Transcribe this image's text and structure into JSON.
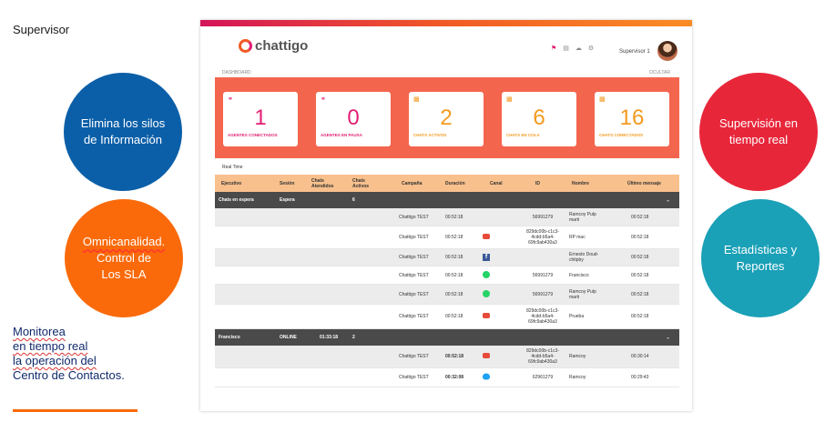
{
  "slide": {
    "title": "Supervisor",
    "circles": [
      {
        "text": "Elimina los silos de Información"
      },
      {
        "lines": [
          "Omnicanalidad.",
          "Control de",
          "Los SLA"
        ]
      },
      {
        "text": "Supervisión en tiempo real"
      },
      {
        "text": "Estadísticas y Reportes"
      }
    ],
    "note": [
      "Monitorea",
      "en tiempo real",
      "la operación del",
      "Centro de Contactos."
    ],
    "colors": {
      "blue": "#0b5fa8",
      "orange": "#fa6a0a",
      "red": "#e8263a",
      "teal": "#1aa0b7"
    }
  },
  "app": {
    "logo_text": "chattigo",
    "user": "Supervisor 1",
    "icons": [
      "notification-icon",
      "clipboard-icon",
      "cloud-icon",
      "settings-icon"
    ],
    "breadcrumb": "DASHBOARD",
    "hide_label": "OCULTAR",
    "cards": [
      {
        "value": "1",
        "label": "AGENTES CONECTADOS",
        "icon": "headset-icon",
        "color": "#e21f73"
      },
      {
        "value": "0",
        "label": "AGENTES EN PAUSA",
        "icon": "headset-icon",
        "color": "#e21f73"
      },
      {
        "value": "2",
        "label": "CHATS ACTIVOS",
        "icon": "chat-icon",
        "color": "#f39a1f"
      },
      {
        "value": "6",
        "label": "CHATS EN COLA",
        "icon": "chat-icon",
        "color": "#f39a1f"
      },
      {
        "value": "16",
        "label": "CHATS CONECTADOS",
        "icon": "chat-icon",
        "color": "#f39a1f"
      }
    ],
    "realtime_label": "Real Time",
    "columns": [
      "Ejecutivo",
      "Sesión",
      "Chats Atendidos",
      "Chats Activos",
      "Campaña",
      "Duración",
      "Canal",
      "ID",
      "Nombre",
      "Último mensaje"
    ],
    "groups": [
      {
        "ejecutivo": "Chats en espera",
        "sesion": "Espera",
        "atendidos": "",
        "activos": "6",
        "rows": [
          {
            "campana": "Chattigo TEST",
            "duracion": "00:52:18",
            "canal": "none",
            "id": "56991279",
            "nombre": "Ramcoy Pulp marti",
            "ultimo": "00:52:18"
          },
          {
            "campana": "Chattigo TEST",
            "duracion": "00:52:18",
            "canal": "chat",
            "id": "829dc00b-c1c3-4cdd-b5a4-69fc9ab430a3",
            "nombre": "RP mac",
            "ultimo": "00:52:18"
          },
          {
            "campana": "Chattigo TEST",
            "duracion": "00:52:18",
            "canal": "facebook",
            "id": "",
            "nombre": "Ernesto Doud-chitpby",
            "ultimo": "00:52:18"
          },
          {
            "campana": "Chattigo TEST",
            "duracion": "00:52:18",
            "canal": "whatsapp",
            "id": "56991279",
            "nombre": "Francisco",
            "ultimo": "00:52:18"
          },
          {
            "campana": "Chattigo TEST",
            "duracion": "00:52:18",
            "canal": "whatsapp",
            "id": "56991279",
            "nombre": "Ramcoy Pulp marti",
            "ultimo": "00:52:18"
          },
          {
            "campana": "Chattigo TEST",
            "duracion": "00:52:18",
            "canal": "chat",
            "id": "829dc00b-c1c3-4cdd-b5a4-69fc9ab430a3",
            "nombre": "Prueba",
            "ultimo": "00:52:18"
          }
        ]
      },
      {
        "ejecutivo": "Francisco",
        "sesion": "ONLINE",
        "atendidos": "01:33:18",
        "activos": "2",
        "rows": [
          {
            "campana": "Chattigo TEST",
            "duracion": "00:52:18",
            "canal": "chat",
            "id": "829dc00b-c1c3-4cdd-b5a4-69fc9ab430a3",
            "nombre": "Ramcoy",
            "ultimo": "00:30:14"
          },
          {
            "campana": "Chattigo TEST",
            "duracion": "00:32:08",
            "canal": "twitter",
            "id": "62961279",
            "nombre": "Ramcoy",
            "ultimo": "00:29:43"
          }
        ]
      }
    ]
  }
}
